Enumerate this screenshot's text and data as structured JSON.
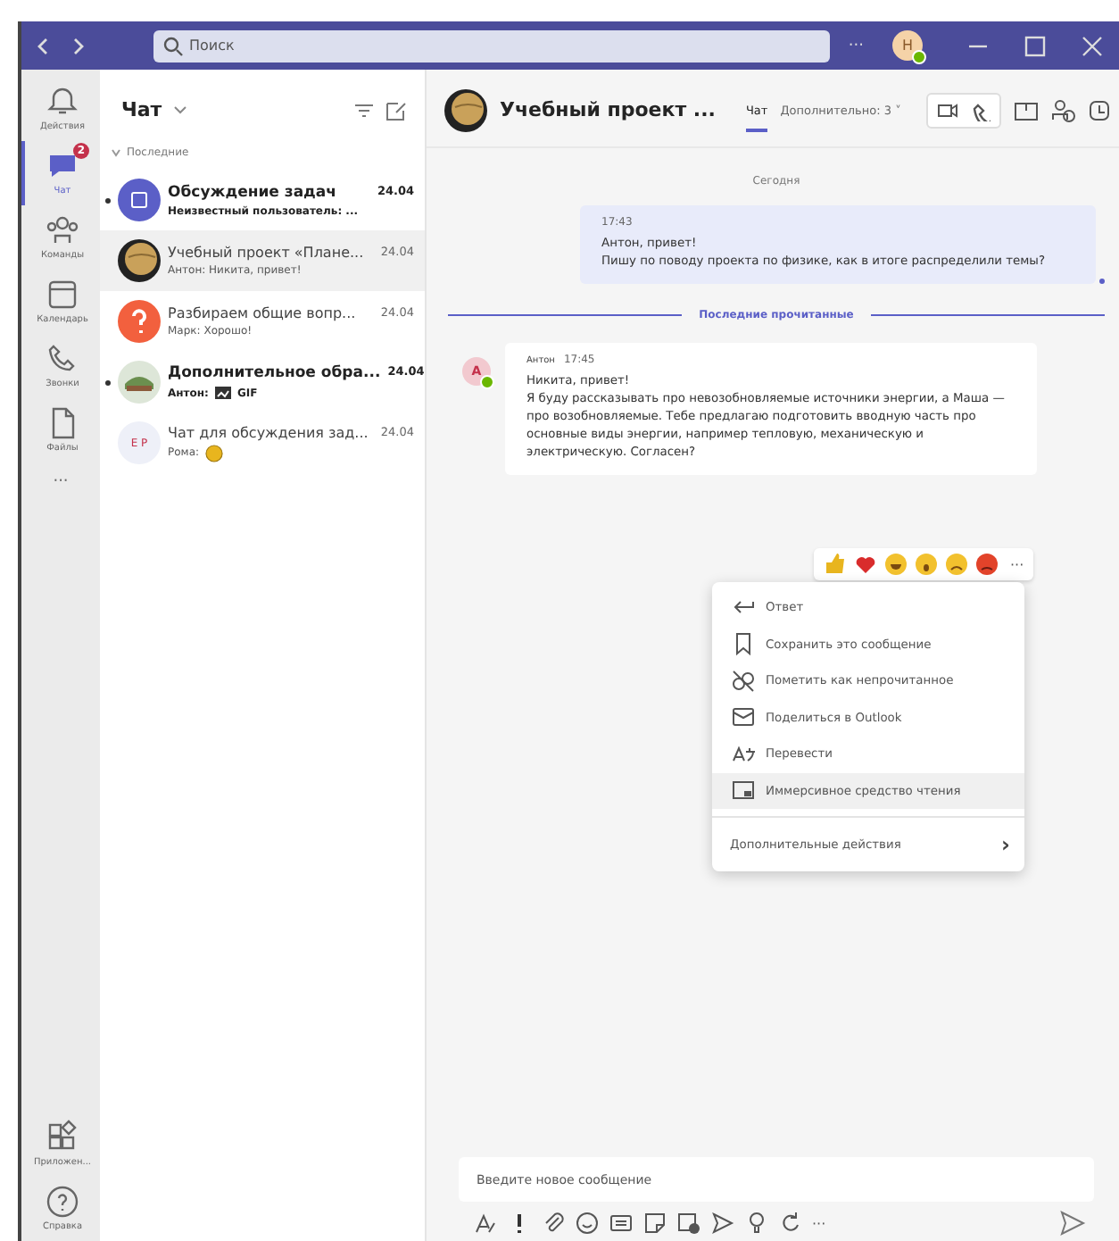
{
  "title_bar": {
    "search": {
      "placeholder": "Поиск"
    },
    "more": "···",
    "avatar": "Н"
  },
  "rail": {
    "items": [
      {
        "label": "Действия",
        "selected": false
      },
      {
        "label": "Чат",
        "selected": true,
        "badge": "2"
      },
      {
        "label": "Команды",
        "selected": false
      },
      {
        "label": "Календарь",
        "selected": false
      },
      {
        "label": "Звонки",
        "selected": false
      },
      {
        "label": "Файлы",
        "selected": false
      }
    ],
    "more": "···",
    "bottom_items": [
      {
        "label": "Приложен...",
        "selected": false
      },
      {
        "label": "Справка",
        "selected": false
      }
    ]
  },
  "chat_list": {
    "title": "Чат",
    "section": "Последние",
    "chats": [
      {
        "kind": "group",
        "name": "Обсуждение задач",
        "preview": "Неизвестный пользователь: ...",
        "date": "24.04",
        "unread": true,
        "selected": false
      },
      {
        "kind": "planet",
        "name": "Учебный проект «Плане...",
        "preview": "Антон: Никита, привет!",
        "date": "24.04",
        "unread": false,
        "selected": true
      },
      {
        "kind": "question",
        "name": "Разбираем общие вопр...",
        "preview": "Марк: Хорошо!",
        "date": "24.04",
        "unread": false,
        "selected": false
      },
      {
        "kind": "photo",
        "name": "Дополнительное обра...",
        "preview": "Антон:",
        "attachment": "GIF",
        "date": "24.04",
        "unread": true,
        "selected": false
      },
      {
        "kind": "initials",
        "initials": "Е Р",
        "name": "Чат для обсуждения зад...",
        "preview": "Рома:",
        "emoji": true,
        "date": "24.04",
        "unread": false,
        "selected": false
      }
    ]
  },
  "conversation": {
    "title": "Учебный проект ...",
    "tabs": [
      {
        "label": "Чат",
        "selected": true
      },
      {
        "label": "Дополнительно: 3 ˅",
        "selected": false
      }
    ],
    "date_divider": "Сегодня",
    "own_message": {
      "time": "17:43",
      "lines": [
        "Антон, привет!",
        "Пишу по поводу проекта по физике, как в итоге распределили темы?"
      ]
    },
    "read_divider": "Последние прочитанные",
    "incoming_message": {
      "author": "Антон",
      "time": "17:45",
      "avatar": "А",
      "lines": [
        "Никита, привет!",
        "Я буду рассказывать про невозобновляемые источники энергии, а Маша — про возобновляемые. Тебе предлагаю подготовить вводную часть про основные виды энергии, например тепловую, механическую и электрическую. Согласен?"
      ]
    },
    "reactions_more": "···",
    "context_menu": {
      "items": [
        {
          "label": "Ответ",
          "selected": false
        },
        {
          "label": "Сохранить это сообщение",
          "selected": false
        },
        {
          "label": "Пометить как непрочитанное",
          "selected": false
        },
        {
          "label": "Поделиться в Outlook",
          "selected": false
        },
        {
          "label": "Перевести",
          "selected": false
        },
        {
          "label": "Иммерсивное средство чтения",
          "selected": true
        }
      ],
      "more": "Дополнительные действия",
      "more_arrow": "›"
    },
    "compose": {
      "placeholder": "Введите новое сообщение",
      "tools_more": "···"
    }
  }
}
